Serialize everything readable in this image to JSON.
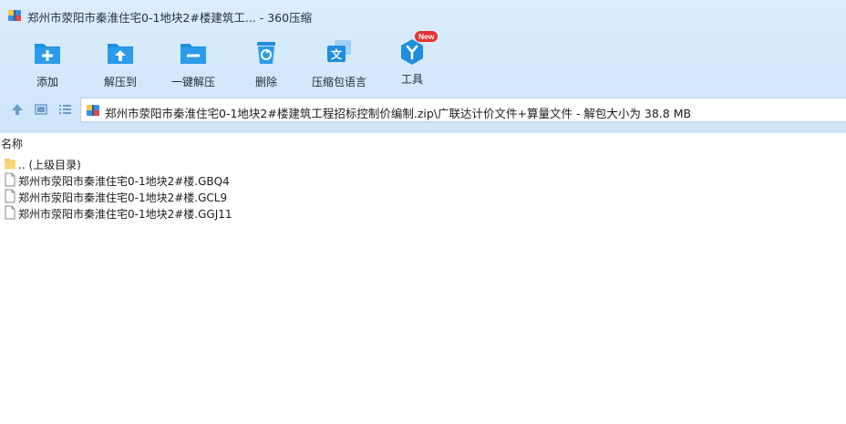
{
  "window": {
    "title": "郑州市荥阳市秦淮住宅0-1地块2#楼建筑工... - 360压缩"
  },
  "toolbar": {
    "items": [
      {
        "label": "添加",
        "icon": "add-icon"
      },
      {
        "label": "解压到",
        "icon": "extract-to-icon"
      },
      {
        "label": "一键解压",
        "icon": "one-click-extract-icon"
      },
      {
        "label": "删除",
        "icon": "delete-icon"
      },
      {
        "label": "压缩包语言",
        "icon": "archive-language-icon"
      },
      {
        "label": "工具",
        "icon": "tools-icon",
        "badge": "New"
      }
    ]
  },
  "path": {
    "text": "郑州市荥阳市秦淮住宅0-1地块2#楼建筑工程招标控制价编制.zip\\广联达计价文件+算量文件 - 解包大小为 38.8 MB"
  },
  "list": {
    "column_name": "名称",
    "rows": [
      {
        "name": ".. (上级目录)",
        "type": "folder"
      },
      {
        "name": "郑州市荥阳市秦淮住宅0-1地块2#楼.GBQ4",
        "type": "file"
      },
      {
        "name": "郑州市荥阳市秦淮住宅0-1地块2#楼.GCL9",
        "type": "file"
      },
      {
        "name": "郑州市荥阳市秦淮住宅0-1地块2#楼.GGJ11",
        "type": "file"
      }
    ]
  },
  "colors": {
    "accent": "#1e8ee0",
    "toolbar_bg": "#d3e8fb",
    "badge": "#e8312f"
  }
}
